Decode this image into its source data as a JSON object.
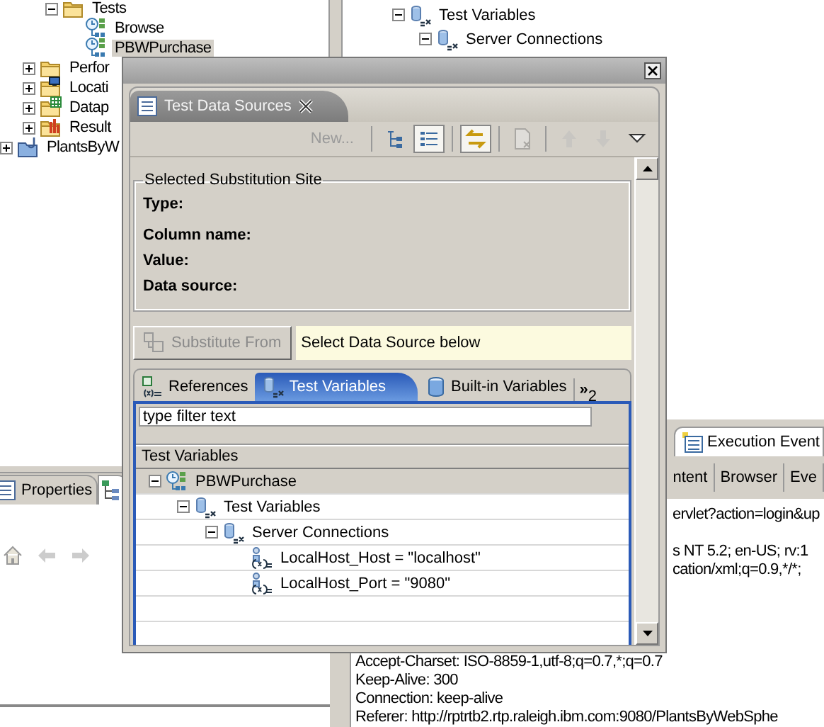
{
  "navigator_tree": [
    {
      "children": [
        {
          "children": [
            {
              "label": "Tests",
              "kind": "folder",
              "expanded": true,
              "selected": false,
              "children": [
                {
                  "label": "Browse",
                  "kind": "test",
                  "selected": false
                },
                {
                  "label": "PBWPurchase",
                  "kind": "test",
                  "selected": true
                }
              ]
            }
          ]
        },
        {
          "label": "Perfor",
          "kind": "location_folder",
          "expanded": false,
          "selected": false
        },
        {
          "label": "Locati",
          "kind": "location",
          "expanded": false,
          "selected": false
        },
        {
          "label": "Datap",
          "kind": "datapool",
          "expanded": false,
          "selected": false
        },
        {
          "label": "Result",
          "kind": "results",
          "expanded": false,
          "selected": false
        }
      ]
    },
    {
      "label": "PlantsByW",
      "kind": "project",
      "expanded": false,
      "selected": false
    }
  ],
  "variables_tree": [
    {
      "label": "Test Variables",
      "kind": "variables",
      "expanded": true,
      "selected": false,
      "children": [
        {
          "label": "Server Connections",
          "kind": "variables",
          "expanded": true,
          "selected": false
        }
      ]
    }
  ],
  "properties_view": {
    "tabs": [
      {
        "label": "Properties",
        "kind": "properties",
        "selected": false
      },
      {
        "kind": "outline",
        "selected": true
      }
    ]
  },
  "execution_view": {
    "tab": "Execution Event",
    "subtabs": [
      {
        "label": "ntent",
        "selected": false
      },
      {
        "label": "Browser",
        "selected": false
      },
      {
        "label": "Eve",
        "selected": false
      }
    ],
    "lines_beside": [
      "ervlet?action=login&up",
      "s NT 5.2; en-US; rv:1",
      "cation/xml;q=0.9,*/*;"
    ],
    "lines": [
      "Accept-Charset: ISO-8859-1,utf-8;q=0.7,*;q=0.7",
      "Keep-Alive: 300",
      "Connection: keep-alive",
      "Referer: http://rptrtb2.rtp.raleigh.ibm.com:9080/PlantsByWebSphe"
    ]
  },
  "dialog": {
    "view_tab": "Test Data Sources",
    "toolbar": [
      {
        "kind": "text",
        "label": "New...",
        "disabled": true,
        "pressed": false
      },
      {
        "kind": "tree",
        "disabled": false,
        "pressed": false
      },
      {
        "kind": "list",
        "disabled": false,
        "pressed": true
      },
      {
        "kind": "sync",
        "disabled": false,
        "pressed": true
      },
      {
        "kind": "remove",
        "disabled": true,
        "pressed": false
      },
      {
        "kind": "up",
        "disabled": true,
        "pressed": false
      },
      {
        "kind": "down",
        "disabled": true,
        "pressed": false
      },
      {
        "kind": "menu",
        "disabled": false,
        "pressed": false
      }
    ],
    "group": {
      "title": "Selected Substitution Site",
      "fields": [
        "Type:",
        "Column name:",
        "Value:",
        "Data source:"
      ]
    },
    "substitute_button": {
      "label": "Substitute From",
      "disabled": true
    },
    "hint": "Select Data Source below",
    "tabs": [
      {
        "label": "References",
        "kind": "references",
        "selected": false
      },
      {
        "label": "Test Variables",
        "kind": "variables",
        "selected": true
      },
      {
        "label": "Built-in Variables",
        "kind": "builtin",
        "selected": false
      }
    ],
    "more_tabs": {
      "label": "»",
      "count": "2"
    },
    "filter": {
      "value": "type filter text"
    },
    "table": {
      "header": "Test Variables",
      "tree": [
        {
          "label": "PBWPurchase",
          "kind": "test",
          "expanded": true,
          "selected": true,
          "children": [
            {
              "label": "Test Variables",
              "kind": "variables",
              "expanded": true,
              "selected": false,
              "children": [
                {
                  "label": "Server Connections",
                  "kind": "variables",
                  "expanded": true,
                  "selected": false,
                  "children": [
                    {
                      "label": "LocalHost_Host = \"localhost\"",
                      "kind": "variable",
                      "selected": false
                    },
                    {
                      "label": "LocalHost_Port = \"9080\"",
                      "kind": "variable",
                      "selected": false
                    }
                  ]
                }
              ]
            }
          ]
        }
      ]
    }
  }
}
